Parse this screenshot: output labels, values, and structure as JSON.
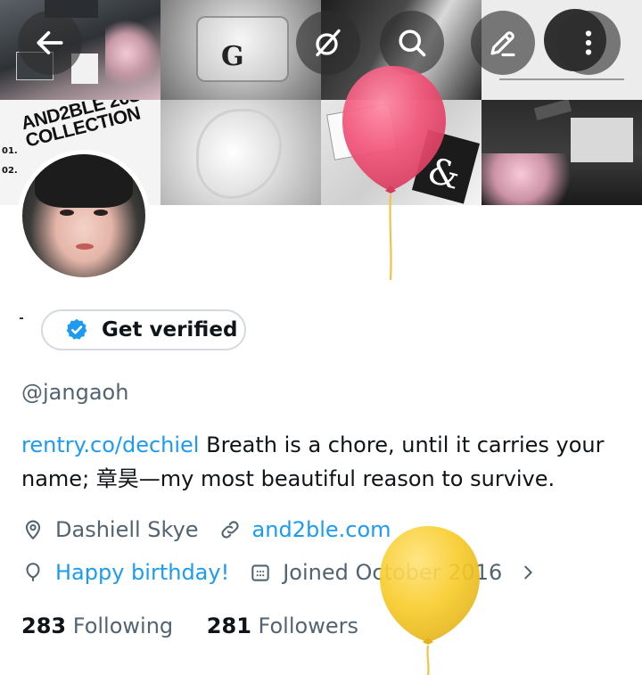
{
  "banner": {
    "tile_text": "AND2BLE 26SS COLLECTION",
    "tile_num_1": "01.",
    "tile_num_2": "02."
  },
  "header_buttons": [
    {
      "name": "back-icon"
    },
    {
      "name": "grok-icon"
    },
    {
      "name": "search-icon"
    },
    {
      "name": "edit-icon"
    },
    {
      "name": "more-icon"
    }
  ],
  "profile": {
    "verify_label": "Get verified",
    "handle": "@jangaoh",
    "bio_link": "rentry.co/dechiel",
    "bio_text": " Breath is a chore, until it carries your name; 章昊—my most beautiful reason to survive.",
    "location": "Dashiell Skye",
    "website": "and2ble.com",
    "birthday": "Happy birthday!",
    "joined": "Joined October 2016",
    "following_count": "283",
    "following_label": "Following",
    "followers_count": "281",
    "followers_label": "Followers"
  },
  "colors": {
    "link": "#1d9bf0",
    "secondary_text": "#536471",
    "verified_badge": "#1d9bf0",
    "balloon_red": "#f2567a",
    "balloon_yellow": "#f8cc2c"
  }
}
